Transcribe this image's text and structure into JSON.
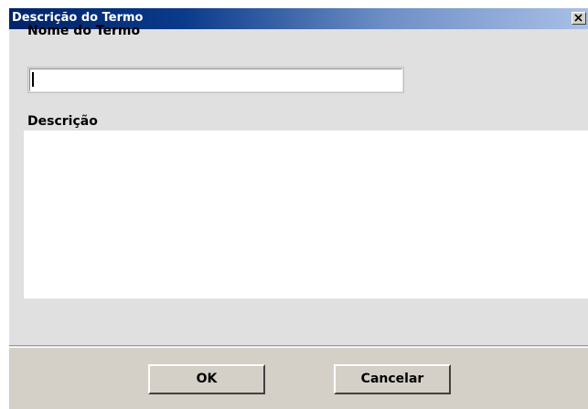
{
  "window": {
    "title": "Descrição do Termo",
    "close_icon": "close-icon"
  },
  "form": {
    "name_label": "Nome do Termo",
    "name_value": "",
    "description_label": "Descrição",
    "description_value": ""
  },
  "buttons": {
    "ok_label": "OK",
    "cancel_label": "Cancelar"
  },
  "colors": {
    "titlebar_start": "#002468",
    "titlebar_end": "#a9c0e6",
    "dialog_background": "#e0e0e0",
    "footer_background": "#d4d0c8"
  }
}
